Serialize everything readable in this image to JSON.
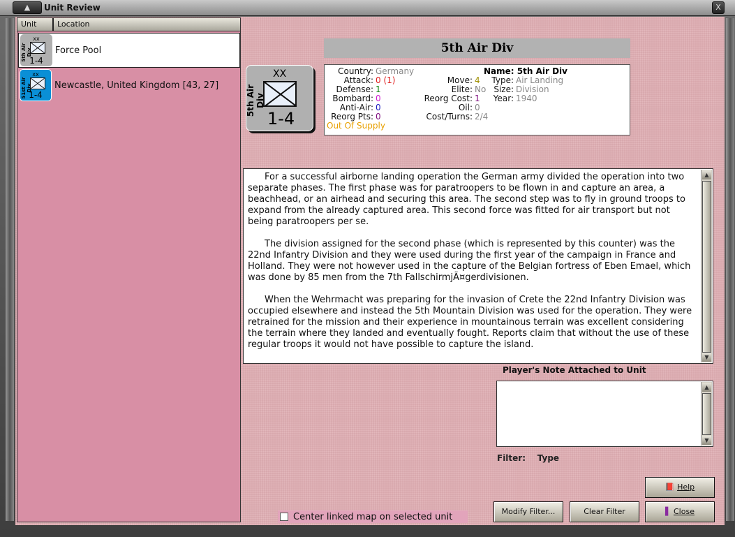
{
  "window": {
    "title": "Unit Review",
    "close_label": "X"
  },
  "list": {
    "columns": [
      "Unit",
      "Location"
    ],
    "rows": [
      {
        "unit_name": "5th Air Div",
        "xx": "xx",
        "strength": "1-4",
        "location": "Force Pool",
        "color": "#b0b0b0",
        "selected": true
      },
      {
        "unit_name": "51st Air Div",
        "xx": "xx",
        "strength": "1-4",
        "location": "Newcastle, United Kingdom [43, 27]",
        "color": "#0a8fd6",
        "selected": false
      }
    ]
  },
  "detail": {
    "title": "5th Air Div",
    "counter": {
      "name": "5th Air Div",
      "xx": "XX",
      "strength": "1-4",
      "color": "#b0b0b0"
    },
    "col1": [
      {
        "label": "Country:",
        "value": "Germany",
        "color": "#888888"
      },
      {
        "label": "Attack:",
        "value": "0 (1)",
        "color": "#e02020"
      },
      {
        "label": "Defense:",
        "value": "1",
        "color": "#118811"
      },
      {
        "label": "Bombard:",
        "value": "0",
        "color": "#d020d0"
      },
      {
        "label": "Anti-Air:",
        "value": "0",
        "color": "#2020c0"
      },
      {
        "label": "Reorg Pts:",
        "value": "0",
        "color": "#801080"
      }
    ],
    "supply": "Out Of Supply",
    "col2": [
      {
        "label": "Move:",
        "value": "4",
        "color": "#a09000"
      },
      {
        "label": "Elite:",
        "value": "No",
        "color": "#888888"
      },
      {
        "label": "Reorg Cost:",
        "value": "1",
        "color": "#801080"
      },
      {
        "label": "Oil:",
        "value": "0",
        "color": "#888888"
      },
      {
        "label": "Cost/Turns:",
        "value": "2/4",
        "color": "#888888"
      }
    ],
    "name_line": "Name: 5th Air Div",
    "col3": [
      {
        "label": "Type:",
        "value": "Air Landing"
      },
      {
        "label": "Size:",
        "value": "Division"
      },
      {
        "label": "Year:",
        "value": "1940"
      }
    ],
    "description": [
      "For a successful airborne landing operation the German army divided the operation into two separate phases. The first phase was for paratroopers to be flown in and capture an area, a beachhead, or an airhead and securing this area.  The second step was to fly in ground troops to expand from the already captured area.  This second force was fitted for air transport but not being paratroopers per se.",
      "The division assigned for the second phase (which is represented by this counter) was the 22nd Infantry Division and they were used during the first year of the campaign in France and Holland.  They were not however used in the capture of the Belgian fortress of Eben Emael, which was done by 85 men from the 7th FallschirmjÃ¤gerdivisionen.",
      "When the Wehrmacht was preparing for the invasion of Crete the 22nd Infantry Division was occupied elsewhere and instead the 5th Mountain Division was used for the operation.  They were retrained for the mission and their experience in mountainous terrain was excellent considering the terrain where they landed and eventually fought.  Reports claim that without the use of these regular troops it would not have possible to capture the island."
    ],
    "note_label": "Player's Note Attached to Unit",
    "note_value": ""
  },
  "filter": {
    "label": "Filter:",
    "value": "Type"
  },
  "buttons": {
    "help": "Help",
    "modify": "Modify Filter...",
    "clear": "Clear Filter",
    "close": "Close"
  },
  "center_map": {
    "label": "Center linked map on selected unit",
    "checked": false
  }
}
